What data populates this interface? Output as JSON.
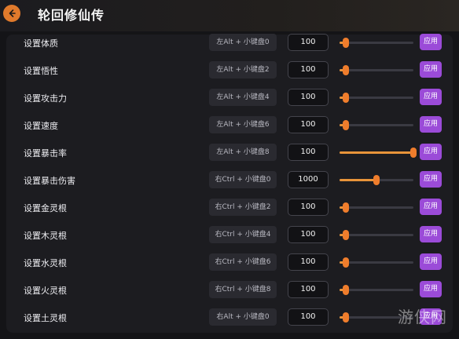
{
  "header": {
    "title": "轮回修仙传",
    "back_icon": "back-arrow-icon"
  },
  "rows": [
    {
      "label": "设置体质",
      "hotkey": "左Alt + 小键盘0",
      "value": "100",
      "slider": 0.08,
      "apply": "应用"
    },
    {
      "label": "设置悟性",
      "hotkey": "左Alt + 小键盘2",
      "value": "100",
      "slider": 0.08,
      "apply": "应用"
    },
    {
      "label": "设置攻击力",
      "hotkey": "左Alt + 小键盘4",
      "value": "100",
      "slider": 0.08,
      "apply": "应用"
    },
    {
      "label": "设置速度",
      "hotkey": "左Alt + 小键盘6",
      "value": "100",
      "slider": 0.08,
      "apply": "应用"
    },
    {
      "label": "设置暴击率",
      "hotkey": "左Alt + 小键盘8",
      "value": "100",
      "slider": 1.0,
      "apply": "应用"
    },
    {
      "label": "设置暴击伤害",
      "hotkey": "右Ctrl + 小键盘0",
      "value": "1000",
      "slider": 0.5,
      "apply": "应用"
    },
    {
      "label": "设置金灵根",
      "hotkey": "右Ctrl + 小键盘2",
      "value": "100",
      "slider": 0.08,
      "apply": "应用"
    },
    {
      "label": "设置木灵根",
      "hotkey": "右Ctrl + 小键盘4",
      "value": "100",
      "slider": 0.08,
      "apply": "应用"
    },
    {
      "label": "设置水灵根",
      "hotkey": "右Ctrl + 小键盘6",
      "value": "100",
      "slider": 0.08,
      "apply": "应用"
    },
    {
      "label": "设置火灵根",
      "hotkey": "右Ctrl + 小键盘8",
      "value": "100",
      "slider": 0.08,
      "apply": "应用"
    },
    {
      "label": "设置土灵根",
      "hotkey": "右Alt + 小键盘0",
      "value": "100",
      "slider": 0.08,
      "apply": "应用"
    }
  ],
  "watermark": "游侠网",
  "colors": {
    "accent": "#ef7d2c",
    "apply": "#9b4bd8",
    "background": "#141417"
  }
}
